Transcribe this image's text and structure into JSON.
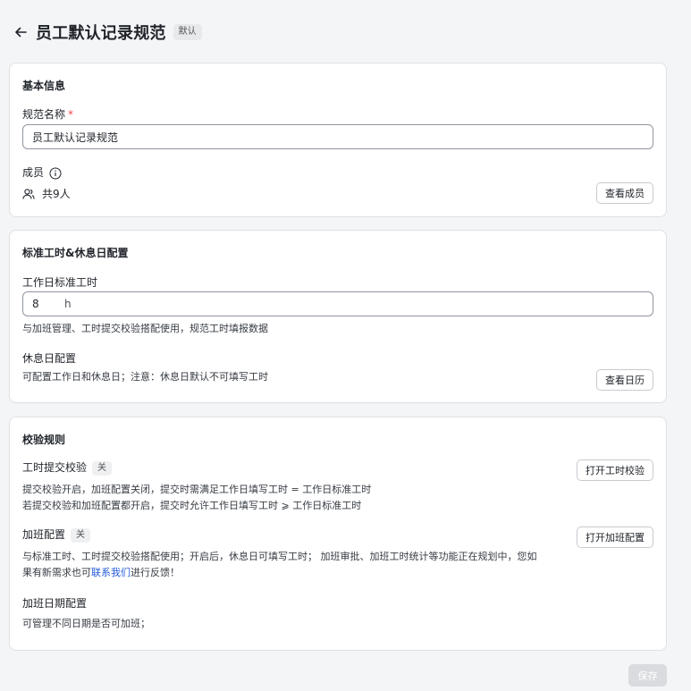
{
  "header": {
    "title": "员工默认记录规范",
    "badge": "默认"
  },
  "basic_info": {
    "title": "基本信息",
    "name_label": "规范名称",
    "name_required_mark": "*",
    "name_value": "员工默认记录规范",
    "members_label": "成员",
    "members_count": "共9人",
    "view_members_button": "查看成员"
  },
  "work_hours": {
    "title": "标准工时&休息日配置",
    "standard_label": "工作日标准工时",
    "standard_value": "8",
    "standard_unit": "h",
    "standard_desc": "与加班管理、工时提交校验搭配使用，规范工时填报数据",
    "rest_label": "休息日配置",
    "rest_desc": "可配置工作日和休息日；注意：休息日默认不可填写工时",
    "view_calendar_button": "查看日历"
  },
  "validation": {
    "title": "校验规则",
    "submit_label": "工时提交校验",
    "submit_status": "关",
    "submit_desc_1": "提交校验开启，加班配置关闭，提交时需满足工作日填写工时 = 工作日标准工时",
    "submit_desc_2": "若提交校验和加班配置都开启，提交时允许工作日填写工时 ⩾ 工作日标准工时",
    "open_submit_button": "打开工时校验",
    "overtime_label": "加班配置",
    "overtime_status": "关",
    "overtime_desc_1": "与标准工时、工时提交校验搭配使用；开启后，休息日可填写工时； 加班审批、加班工时统计等功能正在规划中，您如",
    "overtime_desc_2_pre": "果有新需求也可",
    "overtime_desc_2_link": "联系我们",
    "overtime_desc_2_post": "进行反馈！",
    "open_overtime_button": "打开加班配置",
    "overtime_date_label": "加班日期配置",
    "overtime_date_desc": "可管理不同日期是否可加班；"
  },
  "footer": {
    "save_button": "保存"
  },
  "colors": {
    "accent_link": "#245bdb",
    "required": "#f54a45",
    "page_bg": "#f4f5f7"
  }
}
